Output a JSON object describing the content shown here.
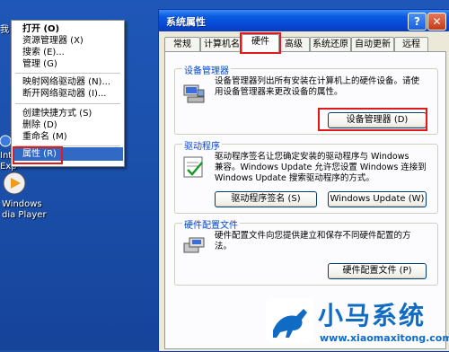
{
  "desktop": {
    "icons": [
      {
        "label_lines": [
          "Int",
          "Exp"
        ]
      },
      {
        "label_lines": [
          "Windows",
          "dia Player"
        ]
      }
    ],
    "partial_label": "我"
  },
  "context_menu": {
    "items": [
      "打开 (O)",
      "资源管理器 (X)",
      "搜索 (E)...",
      "管理 (G)",
      "映射网络驱动器 (N)...",
      "断开网络驱动器 (I)...",
      "创建快捷方式 (S)",
      "删除 (D)",
      "重命名 (M)"
    ],
    "highlighted": "属性 (R)"
  },
  "dialog": {
    "title": "系统属性",
    "tabs": [
      "常规",
      "计算机名",
      "硬件",
      "高级",
      "系统还原",
      "自动更新",
      "远程"
    ],
    "active_tab": "硬件",
    "groups": {
      "device_manager": {
        "title": "设备管理器",
        "desc_lines": [
          "设备管理器列出所有安装在计算机上的硬件设备。请使",
          "用设备管理器来更改设备的属性。"
        ],
        "button": "设备管理器 (D)"
      },
      "drivers": {
        "title": "驱动程序",
        "desc_lines": [
          "驱动程序签名让您确定安装的驱动程序与 Windows",
          "兼容。Windows Update 允许您设置 Windows 连接到",
          "Windows Update 搜索驱动程序的方式。"
        ],
        "buttons": [
          "驱动程序签名 (S)",
          "Windows Update (W)"
        ]
      },
      "hardware_profiles": {
        "title": "硬件配置文件",
        "desc_lines": [
          "硬件配置文件向您提供建立和保存不同硬件配置的方",
          "法。"
        ],
        "button": "硬件配置文件 (P)"
      }
    }
  },
  "watermark": {
    "text": "小马系统",
    "url": "www.xiaomaxitong.com"
  },
  "colors": {
    "accent_red": "#e01a1a",
    "xp_blue": "#0549d6",
    "highlight": "#316ac5"
  }
}
